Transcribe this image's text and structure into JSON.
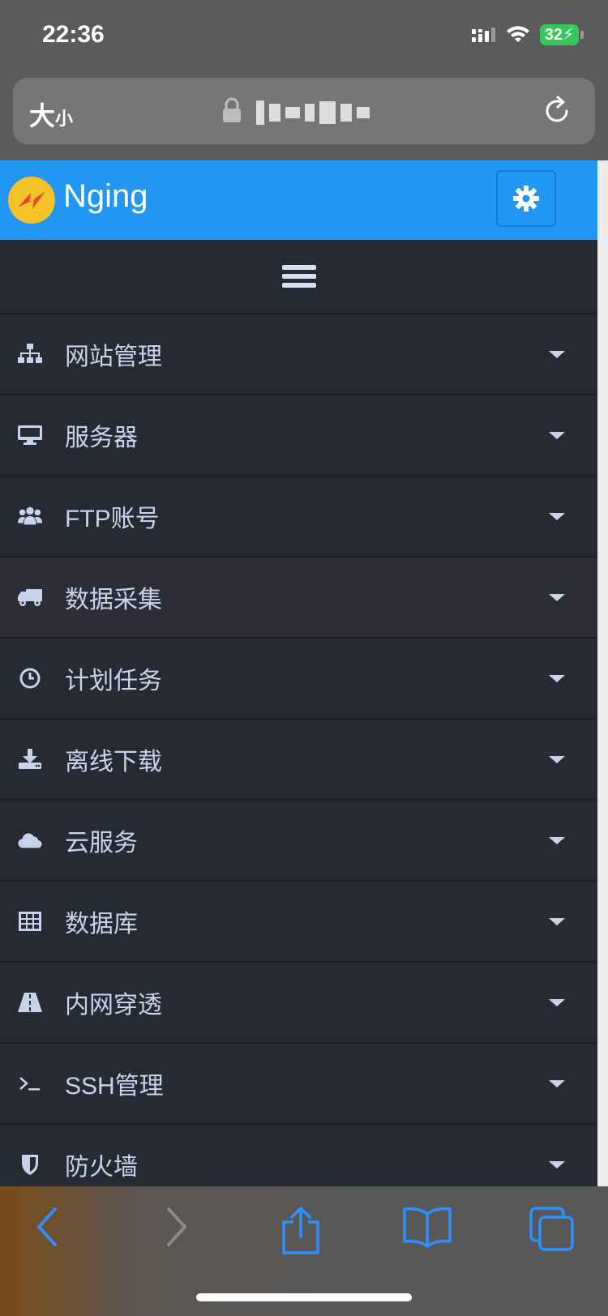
{
  "status": {
    "time": "22:36",
    "battery": "32"
  },
  "browser": {
    "text_size_label_big": "大",
    "text_size_label_small": "小"
  },
  "app": {
    "brand": "Nging",
    "colors": {
      "header": "#2196f3",
      "sidebar": "#262a33",
      "text": "#c7d3ec"
    }
  },
  "nav": {
    "items": [
      {
        "label": "网站管理",
        "icon": "sitemap-icon"
      },
      {
        "label": "服务器",
        "icon": "desktop-icon"
      },
      {
        "label": "FTP账号",
        "icon": "users-icon"
      },
      {
        "label": "数据采集",
        "icon": "truck-icon"
      },
      {
        "label": "计划任务",
        "icon": "clock-icon"
      },
      {
        "label": "离线下载",
        "icon": "download-icon"
      },
      {
        "label": "云服务",
        "icon": "cloud-icon"
      },
      {
        "label": "数据库",
        "icon": "table-icon"
      },
      {
        "label": "内网穿透",
        "icon": "road-icon"
      },
      {
        "label": "SSH管理",
        "icon": "terminal-icon"
      },
      {
        "label": "防火墙",
        "icon": "shield-icon"
      }
    ]
  }
}
